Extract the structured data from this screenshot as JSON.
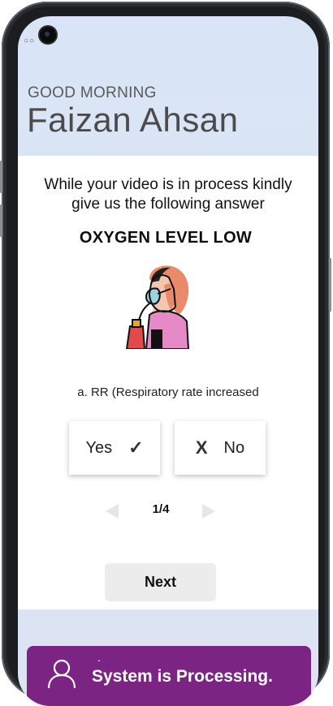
{
  "header": {
    "greeting": "GOOD MORNING",
    "username": "Faizan Ahsan"
  },
  "card": {
    "prompt_line1": "While your video is in process kindly",
    "prompt_line2": "give us the following answer",
    "title": "OXYGEN LEVEL LOW",
    "illustration_icon": "patient-oxygen-mask-icon",
    "question": "a. RR (Respiratory rate increased",
    "options": {
      "yes_label": "Yes",
      "yes_mark": "✓",
      "no_mark": "X",
      "no_label": "No"
    },
    "pager": {
      "indicator": "1/4"
    },
    "next_label": "Next"
  },
  "banner": {
    "icon": "person-icon",
    "text": "System is Processing."
  },
  "colors": {
    "banner_bg": "#7b2483",
    "header_bg": "#d9e5f6",
    "card_bg": "#ffffff",
    "button_bg": "#ececec"
  }
}
